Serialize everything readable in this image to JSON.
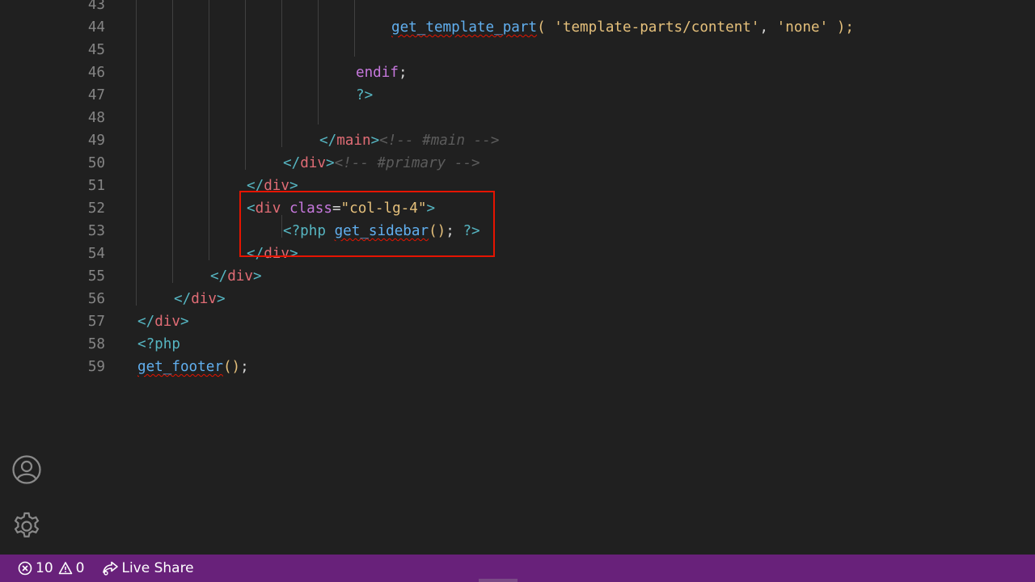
{
  "editor": {
    "lines": [
      {
        "num": "43",
        "tokens": []
      },
      {
        "num": "44",
        "tokens": [
          {
            "text": "get_template_part",
            "cls": "t-fn"
          },
          {
            "text": "( ",
            "cls": "t-paren"
          },
          {
            "text": "'template-parts/content'",
            "cls": "t-str"
          },
          {
            "text": ", ",
            "cls": "t-plain"
          },
          {
            "text": "'none'",
            "cls": "t-str"
          },
          {
            "text": " );",
            "cls": "t-paren"
          }
        ]
      },
      {
        "num": "45",
        "tokens": []
      },
      {
        "num": "46",
        "tokens": [
          {
            "text": "endif",
            "cls": "t-kw"
          },
          {
            "text": ";",
            "cls": "t-plain"
          }
        ]
      },
      {
        "num": "47",
        "tokens": [
          {
            "text": "?>",
            "cls": "t-php"
          }
        ]
      },
      {
        "num": "48",
        "tokens": []
      },
      {
        "num": "49",
        "tokens": [
          {
            "text": "</",
            "cls": "t-br"
          },
          {
            "text": "main",
            "cls": "t-tag"
          },
          {
            "text": ">",
            "cls": "t-br"
          },
          {
            "text": "<!-- #main -->",
            "cls": "t-cm"
          }
        ]
      },
      {
        "num": "50",
        "tokens": [
          {
            "text": "</",
            "cls": "t-br"
          },
          {
            "text": "div",
            "cls": "t-tag"
          },
          {
            "text": ">",
            "cls": "t-br"
          },
          {
            "text": "<!-- #primary -->",
            "cls": "t-cm"
          }
        ]
      },
      {
        "num": "51",
        "tokens": [
          {
            "text": "</",
            "cls": "t-br"
          },
          {
            "text": "div",
            "cls": "t-tag"
          },
          {
            "text": ">",
            "cls": "t-br"
          }
        ]
      },
      {
        "num": "52",
        "tokens": [
          {
            "text": "<",
            "cls": "t-br"
          },
          {
            "text": "div",
            "cls": "t-tag"
          },
          {
            "text": " class",
            "cls": "t-attr"
          },
          {
            "text": "=",
            "cls": "t-plain"
          },
          {
            "text": "\"col-lg-4\"",
            "cls": "t-str"
          },
          {
            "text": ">",
            "cls": "t-br"
          }
        ]
      },
      {
        "num": "53",
        "tokens": [
          {
            "text": "<?php ",
            "cls": "t-php"
          },
          {
            "text": "get_sidebar",
            "cls": "t-fn"
          },
          {
            "text": "()",
            "cls": "t-paren"
          },
          {
            "text": "; ",
            "cls": "t-plain"
          },
          {
            "text": "?>",
            "cls": "t-php"
          }
        ]
      },
      {
        "num": "54",
        "tokens": [
          {
            "text": "</",
            "cls": "t-br"
          },
          {
            "text": "div",
            "cls": "t-tag"
          },
          {
            "text": ">",
            "cls": "t-br"
          }
        ]
      },
      {
        "num": "55",
        "tokens": [
          {
            "text": "</",
            "cls": "t-br"
          },
          {
            "text": "div",
            "cls": "t-tag"
          },
          {
            "text": ">",
            "cls": "t-br"
          }
        ]
      },
      {
        "num": "56",
        "tokens": [
          {
            "text": "</",
            "cls": "t-br"
          },
          {
            "text": "div",
            "cls": "t-tag"
          },
          {
            "text": ">",
            "cls": "t-br"
          }
        ]
      },
      {
        "num": "57",
        "tokens": [
          {
            "text": "</",
            "cls": "t-br"
          },
          {
            "text": "div",
            "cls": "t-tag"
          },
          {
            "text": ">",
            "cls": "t-br"
          }
        ]
      },
      {
        "num": "58",
        "tokens": [
          {
            "text": "<?php",
            "cls": "t-php"
          }
        ]
      },
      {
        "num": "59",
        "tokens": [
          {
            "text": "get_footer",
            "cls": "t-fn"
          },
          {
            "text": "()",
            "cls": "t-paren"
          },
          {
            "text": ";",
            "cls": "t-plain"
          }
        ]
      }
    ]
  },
  "activity_bar": {
    "accounts_icon": "account-icon",
    "settings_icon": "gear-icon"
  },
  "statusbar": {
    "errors_count": "10",
    "warnings_count": "0",
    "live_share_label": "Live Share",
    "background_color": "#68217a"
  },
  "colors": {
    "highlight_border": "#e51400",
    "editor_background": "#202020"
  }
}
